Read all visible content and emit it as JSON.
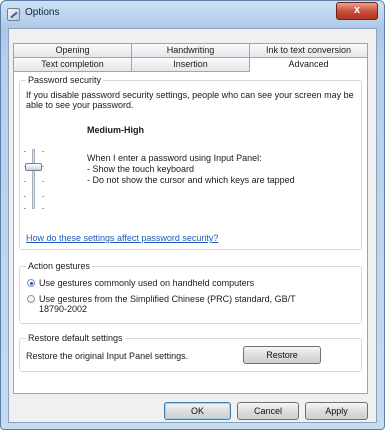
{
  "window": {
    "title": "Options",
    "close_glyph": "x"
  },
  "tabs": {
    "back_row": [
      "Opening",
      "Handwriting",
      "Ink to text conversion"
    ],
    "front_row": [
      "Text completion",
      "Insertion",
      "Advanced"
    ],
    "active": "Advanced"
  },
  "password_security": {
    "label": "Password security",
    "description": "If you disable password security settings, people who can see your screen may be able to see your password.",
    "level_title": "Medium-High",
    "level_fraction": 0.67,
    "details_heading": "When I enter a password using Input Panel:",
    "details_line1": "- Show the touch keyboard",
    "details_line2": "- Do not show the cursor and which keys are tapped",
    "help_link": "How do these settings affect password security?"
  },
  "action_gestures": {
    "label": "Action gestures",
    "option1": "Use gestures commonly used on handheld computers",
    "option2_line1": "Use gestures from the Simplified Chinese (PRC) standard, GB/T",
    "option2_line2": "18790-2002",
    "selected": "option1"
  },
  "restore_defaults": {
    "label": "Restore default settings",
    "description": "Restore the original Input Panel settings.",
    "button_label": "Restore"
  },
  "footer": {
    "ok_label": "OK",
    "cancel_label": "Cancel",
    "apply_label": "Apply"
  }
}
